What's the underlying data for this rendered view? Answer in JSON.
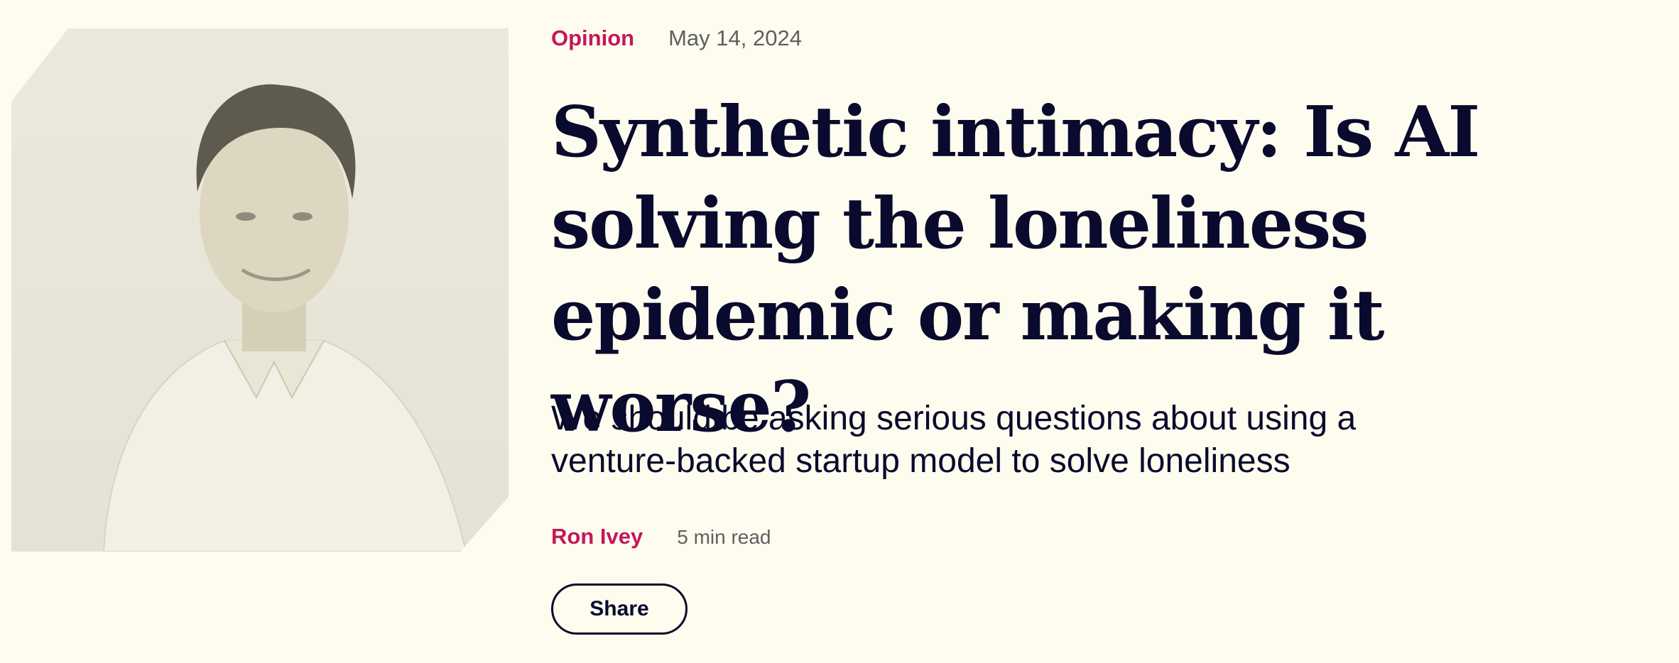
{
  "article": {
    "category": "Opinion",
    "date": "May 14, 2024",
    "title": "Synthetic intimacy: Is AI solving the loneliness epidemic or making it worse?",
    "subtitle": "We should be asking serious questions about using a venture-backed startup model to solve loneliness",
    "author": "Ron Ivey",
    "read_time": "5 min read"
  },
  "actions": {
    "share_label": "Share"
  },
  "colors": {
    "background": "#fdfcee",
    "accent": "#c4175b",
    "text": "#0a0a2e",
    "muted": "#5f5f5f"
  }
}
